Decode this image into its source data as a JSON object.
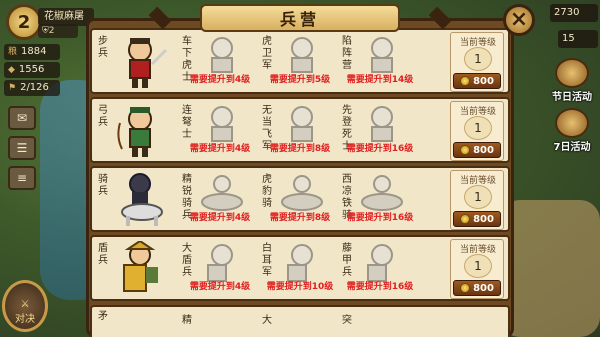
{
  "player": {
    "level": "2",
    "name": "花椒麻屠",
    "rank": "2",
    "resources": [
      {
        "icon": "grain-icon",
        "value": "1884"
      },
      {
        "icon": "wood-icon",
        "value": "1556"
      },
      {
        "icon": "troops-icon",
        "value": "2/126"
      }
    ]
  },
  "right_hud": {
    "top_res_1": "2730",
    "top_res_2": "15",
    "events": [
      {
        "label": "节日活动"
      },
      {
        "label": "7日活动"
      }
    ]
  },
  "left_hud": {
    "duel_label": "对决"
  },
  "panel": {
    "title": "兵营",
    "close": "×",
    "level_label": "当前等级",
    "rows": [
      {
        "category": "步兵",
        "units": [
          {
            "name": "车下虎士",
            "req": "需要提升到4级"
          },
          {
            "name": "虎卫军",
            "req": "需要提升到5级"
          },
          {
            "name": "陷阵营",
            "req": "需要提升到14级"
          }
        ],
        "level": "1",
        "cost": "800"
      },
      {
        "category": "弓兵",
        "units": [
          {
            "name": "连弩士",
            "req": "需要提升到4级"
          },
          {
            "name": "无当飞军",
            "req": "需要提升到8级"
          },
          {
            "name": "先登死士",
            "req": "需要提升到16级"
          }
        ],
        "level": "1",
        "cost": "800"
      },
      {
        "category": "骑兵",
        "units": [
          {
            "name": "精锐骑兵",
            "req": "需要提升到4级"
          },
          {
            "name": "虎豹骑",
            "req": "需要提升到8级"
          },
          {
            "name": "西凉铁骑",
            "req": "需要提升到16级"
          }
        ],
        "level": "1",
        "cost": "800"
      },
      {
        "category": "盾兵",
        "units": [
          {
            "name": "大盾兵",
            "req": "需要提升到4级"
          },
          {
            "name": "白耳军",
            "req": "需要提升到10级"
          },
          {
            "name": "藤甲兵",
            "req": "需要提升到16级"
          }
        ],
        "level": "1",
        "cost": "800"
      }
    ],
    "partial_row": {
      "category": "矛",
      "units": [
        "精",
        "大",
        "突"
      ]
    }
  },
  "colors": {
    "panel_brown": "#6e4a22",
    "row_bg": "#f2e6c8",
    "req_red": "#e02020",
    "button_brown": "#a05a20"
  }
}
